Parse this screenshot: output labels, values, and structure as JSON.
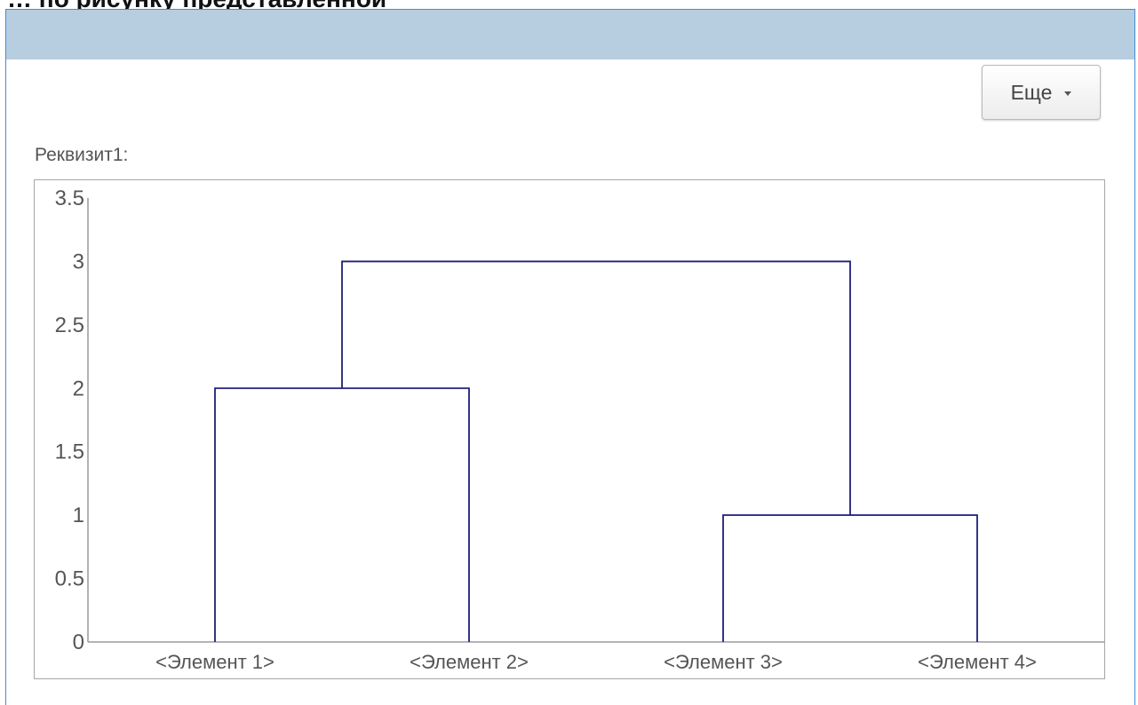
{
  "top_caption": "… по рисунку представленной",
  "form": {
    "more_button_label": "Еще",
    "field_label": "Реквизит1:"
  },
  "colors": {
    "accent_border": "#3f8fd8",
    "header_background": "#b7cde0",
    "dendrogram_line": "#1f1f7a"
  },
  "chart_data": {
    "type": "dendrogram",
    "title": "",
    "xlabel": "",
    "ylabel": "",
    "ylim": [
      0,
      3.5
    ],
    "yticks": [
      "0",
      "0.5",
      "1",
      "1.5",
      "2",
      "2.5",
      "3",
      "3.5"
    ],
    "leaves": [
      "<Элемент 1>",
      "<Элемент 2>",
      "<Элемент 3>",
      "<Элемент 4>"
    ],
    "merges": [
      {
        "members": [
          "<Элемент 1>",
          "<Элемент 2>"
        ],
        "height": 2
      },
      {
        "members": [
          "<Элемент 3>",
          "<Элемент 4>"
        ],
        "height": 1
      },
      {
        "members": [
          "<Элемент 1> + <Элемент 2>",
          "<Элемент 3> + <Элемент 4>"
        ],
        "height": 3
      }
    ],
    "grid": false,
    "legend": "none"
  }
}
